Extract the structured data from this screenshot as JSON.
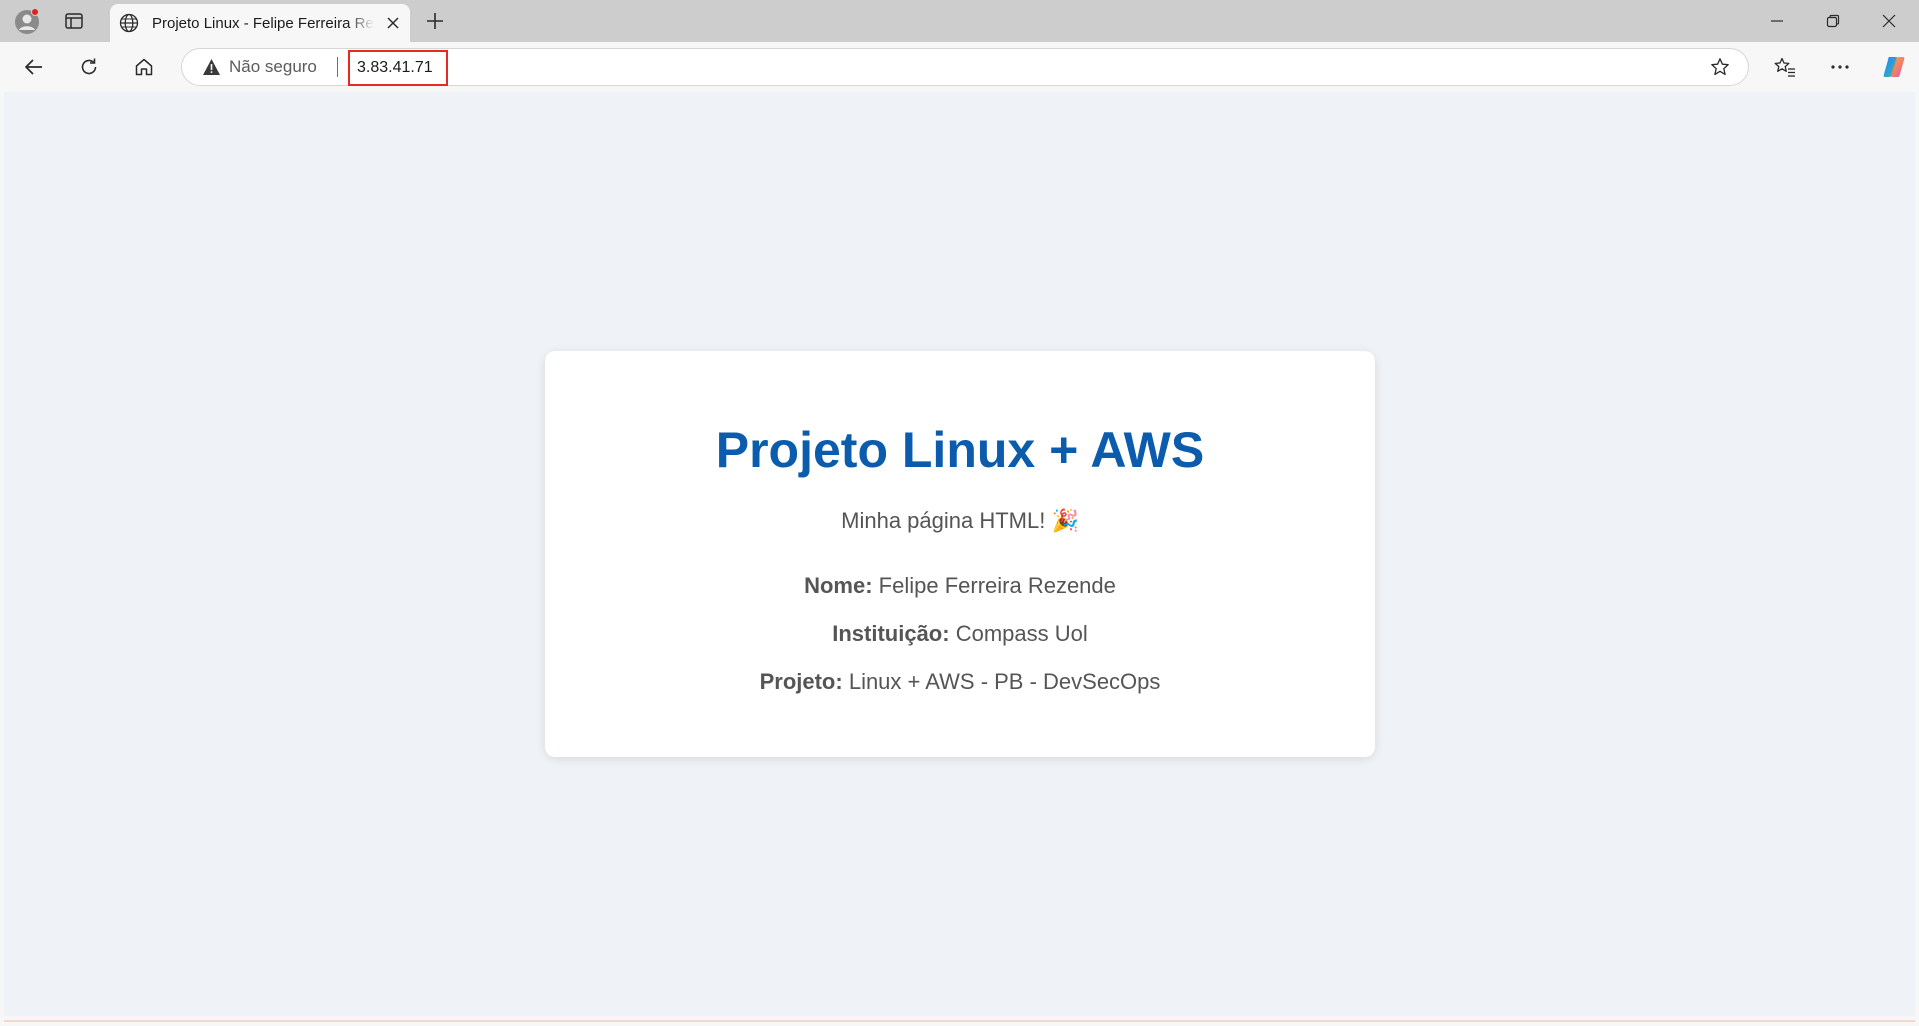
{
  "browser": {
    "tab_title": "Projeto Linux - Felipe Ferreira Rezende",
    "security_label": "Não seguro",
    "url": "3.83.41.71",
    "colors": {
      "url_highlight": "#e52b1e"
    }
  },
  "page": {
    "heading": "Projeto Linux + AWS",
    "subtitle": "Minha página HTML! 🎉",
    "fields": [
      {
        "label": "Nome:",
        "value": "Felipe Ferreira Rezende"
      },
      {
        "label": "Instituição:",
        "value": "Compass Uol"
      },
      {
        "label": "Projeto:",
        "value": "Linux + AWS - PB - DevSecOps"
      }
    ],
    "colors": {
      "heading": "#0b5cad",
      "background": "#eff2f6",
      "card": "#ffffff"
    }
  },
  "icons": {
    "profile": "profile-icon",
    "tab_actions": "tab-actions-icon",
    "favicon": "globe-icon",
    "tab_close": "close-icon",
    "new_tab": "plus-icon",
    "minimize": "minimize-icon",
    "restore": "restore-icon",
    "close_window": "close-icon",
    "back": "back-arrow-icon",
    "refresh": "refresh-icon",
    "home": "home-icon",
    "warning": "warning-icon",
    "favorite": "star-icon",
    "favorites": "favorites-icon",
    "more": "more-icon",
    "copilot": "copilot-icon"
  }
}
